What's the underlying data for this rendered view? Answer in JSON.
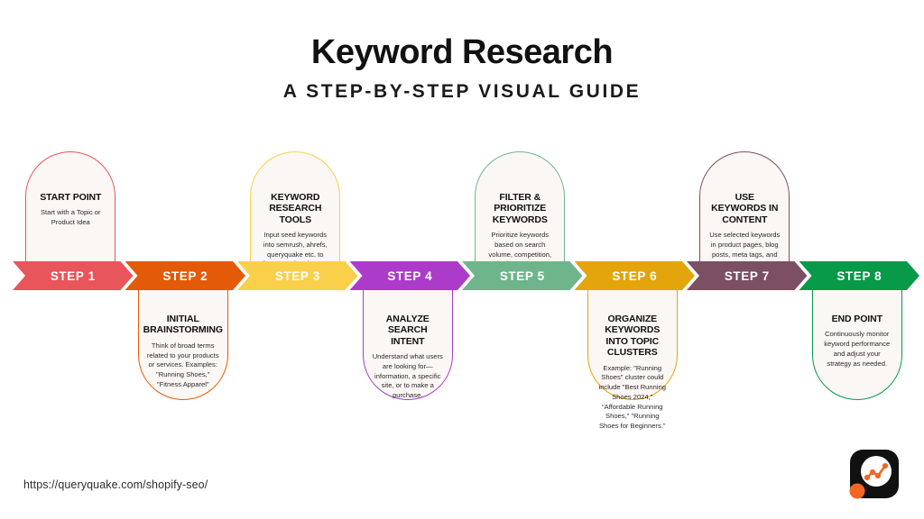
{
  "header": {
    "title": "Keyword Research",
    "subtitle": "A STEP-BY-STEP VISUAL GUIDE"
  },
  "footer": {
    "url": "https://queryquake.com/shopify-seo/",
    "logo_name": "queryquake-logo"
  },
  "colors": {
    "background": "#ffffff",
    "card_fill": "#FBF7F4",
    "title_text": "#111111",
    "body_text": "#2b2b2b",
    "band_text": "#ffffff",
    "logo_mark": "#111111",
    "logo_accent": "#F26522"
  },
  "steps": [
    {
      "band_label": "STEP 1",
      "title": "START POINT",
      "body": "Start with a Topic or Product Idea",
      "color": "#E8555B",
      "position": "above"
    },
    {
      "band_label": "STEP 2",
      "title": "INITIAL BRAINSTORMING",
      "body": "Think of broad terms related to your products or services. Examples: \"Running Shoes,\" \"Fitness Apparel\"",
      "color": "#E35B08",
      "position": "below"
    },
    {
      "band_label": "STEP 3",
      "title": "KEYWORD RESEARCH TOOLS",
      "body": "Input seed keywords into semrush, ahrefs, queryquake etc. to discover related terms, search volume, and competition.",
      "color": "#FAD04A",
      "position": "above"
    },
    {
      "band_label": "STEP 4",
      "title": "ANALYZE SEARCH INTENT",
      "body": "Understand what users are looking for—information, a specific site, or to make a purchase.",
      "color": "#AC3BC9",
      "position": "below"
    },
    {
      "band_label": "STEP 5",
      "title": "FILTER & PRIORITIZE KEYWORDS",
      "body": "Prioritize keywords based on search volume, competition, and relevance to your products.",
      "color": "#6FB58C",
      "position": "above"
    },
    {
      "band_label": "STEP 6",
      "title": "ORGANIZE KEYWORDS INTO TOPIC CLUSTERS",
      "body": "Example: \"Running Shoes\" cluster could include \"Best Running Shoes 2024,\" \"Affordable Running Shoes,\" \"Running Shoes for Beginners.\"",
      "color": "#E3A50B",
      "position": "below"
    },
    {
      "band_label": "STEP 7",
      "title": "USE KEYWORDS IN CONTENT",
      "body": "Use selected keywords in product pages, blog posts, meta tags, and URLs.",
      "color": "#7C4F62",
      "position": "above"
    },
    {
      "band_label": "STEP 8",
      "title": "END POINT",
      "body": "Continuously monitor keyword performance and adjust your strategy as needed.",
      "color": "#089949",
      "position": "below"
    }
  ]
}
